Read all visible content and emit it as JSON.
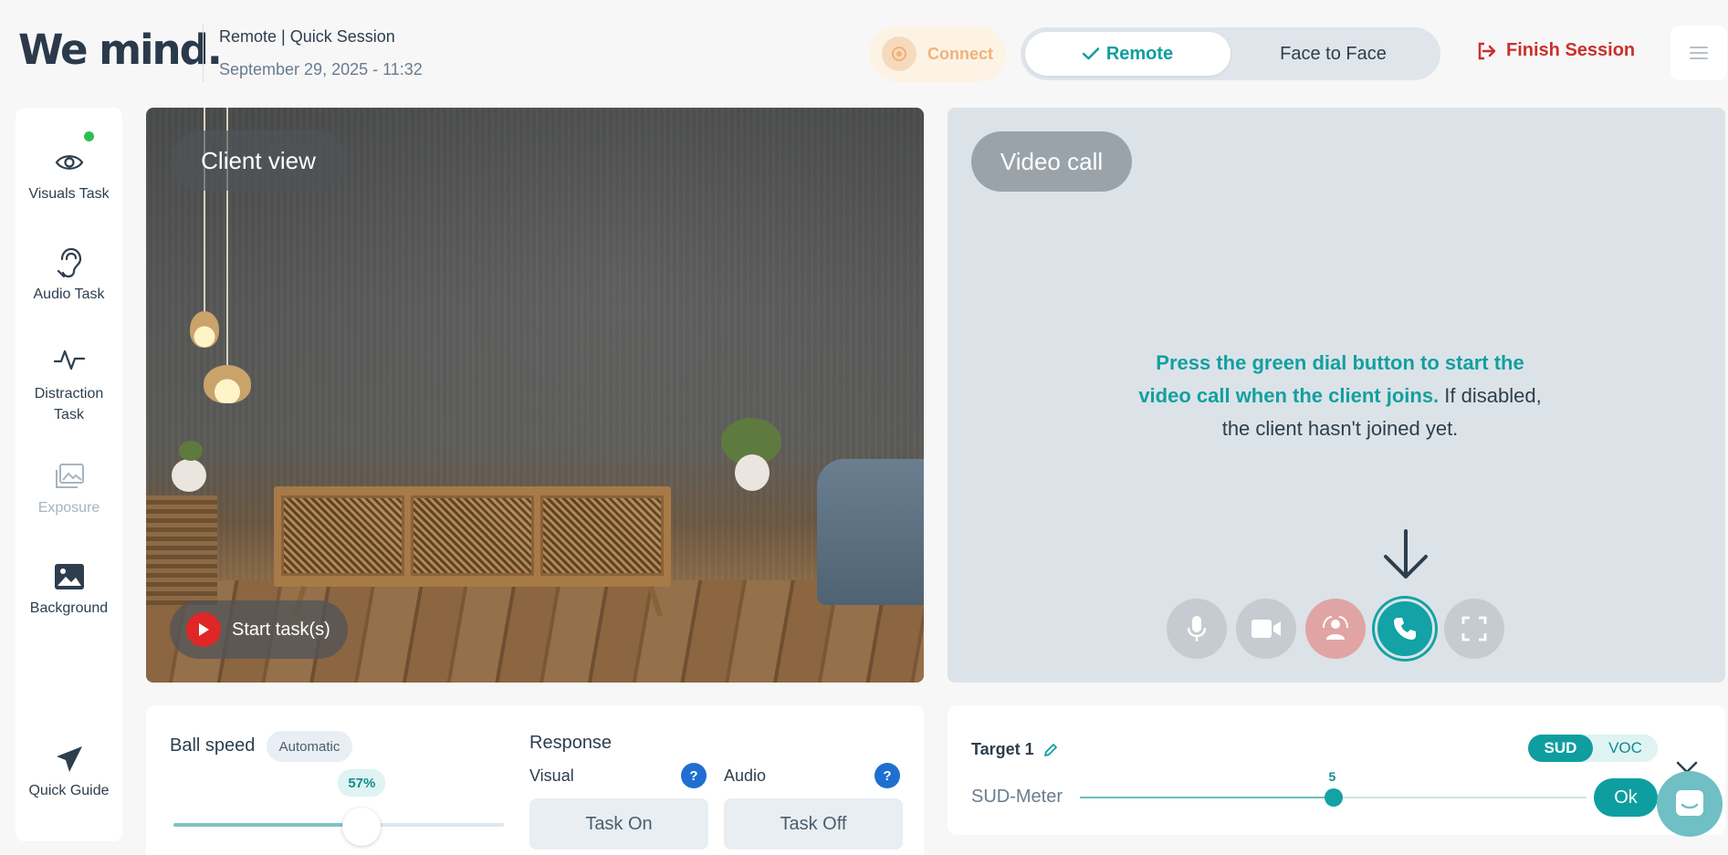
{
  "header": {
    "logo": "We mind.",
    "session_title": "Remote  | Quick Session",
    "session_date": "September 29, 2025 - 11:32",
    "connect_label": "Connect",
    "mode_options": [
      "Remote",
      "Face to Face"
    ],
    "mode_selected": "Remote",
    "finish_label": "Finish Session"
  },
  "sidebar": {
    "items": [
      {
        "label": "Visuals Task",
        "icon": "eye-icon",
        "status": "online"
      },
      {
        "label": "Audio Task",
        "icon": "ear-icon"
      },
      {
        "label": "Distraction Task",
        "icon": "pulse-icon"
      },
      {
        "label": "Exposure",
        "icon": "images-icon",
        "disabled": true
      },
      {
        "label": "Background",
        "icon": "image-icon"
      }
    ],
    "quick_guide": {
      "label": "Quick Guide",
      "icon": "paper-plane-icon"
    }
  },
  "client_view": {
    "label": "Client view",
    "start_task_label": "Start task(s)"
  },
  "video_call": {
    "label": "Video call",
    "message_highlight": "Press the green dial button to start the video call when the client joins.",
    "message_rest": " If disabled, the client hasn't joined yet.",
    "controls": [
      "mic-icon",
      "camera-icon",
      "screen-share-icon",
      "phone-dial-icon",
      "fullscreen-icon"
    ]
  },
  "ball_panel": {
    "title": "Ball speed",
    "mode_chip": "Automatic",
    "speed_label": "57%",
    "speed_value": 0.57
  },
  "response": {
    "title": "Response",
    "visual_label": "Visual",
    "audio_label": "Audio",
    "help_label": "?",
    "visual_button": "Task On",
    "audio_button": "Task Off"
  },
  "sud_panel": {
    "target_label": "Target 1",
    "scale_options": [
      "SUD",
      "VOC"
    ],
    "scale_selected": "SUD",
    "meter_label": "SUD-Meter",
    "meter_value": "5",
    "meter_min": 0,
    "meter_max": 10,
    "ok_label": "Ok"
  },
  "colors": {
    "accent": "#0f9ea0",
    "danger": "#c8312a",
    "connect": "#f0b27a",
    "help": "#1f6fd1"
  }
}
